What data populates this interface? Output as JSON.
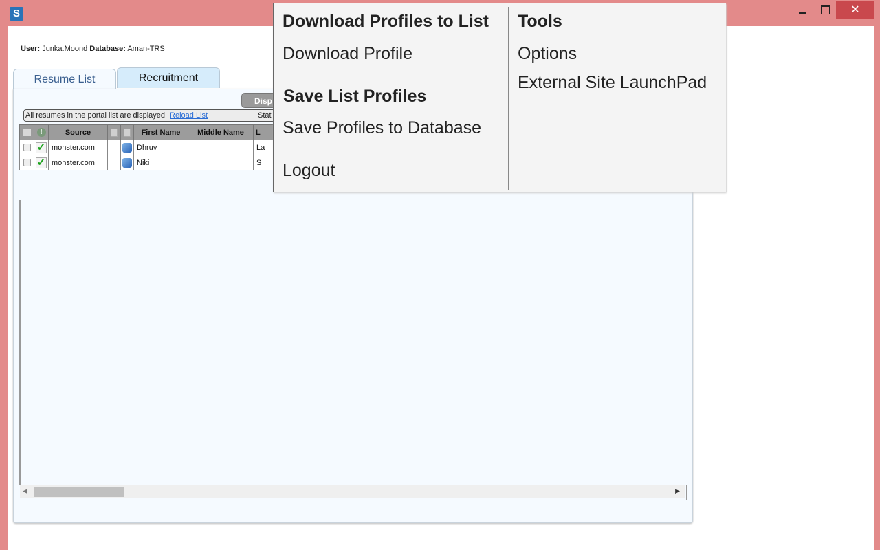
{
  "window": {
    "app_icon": "S",
    "controls": {
      "minimize": "minimize",
      "maximize": "maximize",
      "close": "✕"
    }
  },
  "user_info": {
    "user_label": "User:",
    "user": "Junka.Moond",
    "database_label": "Database:",
    "database": "Aman-TRS"
  },
  "tabs": [
    {
      "label": "Resume List",
      "active": true
    },
    {
      "label": "Recruitment",
      "active": false
    }
  ],
  "toolbar": {
    "display_button": "Disp"
  },
  "status": {
    "message": "All resumes in the portal list are displayed",
    "reload_link": "Reload List",
    "stat_label": "Stat"
  },
  "grid": {
    "columns": [
      "",
      "!",
      "Source",
      "",
      "",
      "First Name",
      "Middle Name",
      "L"
    ],
    "rows": [
      {
        "checked": false,
        "verified": true,
        "source": "monster.com",
        "first_name": "Dhruv",
        "middle_name": "",
        "last_name": "La"
      },
      {
        "checked": false,
        "verified": true,
        "source": "monster.com",
        "first_name": "Niki",
        "middle_name": "",
        "last_name": "S"
      }
    ]
  },
  "menu": {
    "left": {
      "header1": "Download Profiles to List",
      "item1": "Download Profile",
      "header2": "Save List Profiles",
      "item2": "Save Profiles to Database",
      "item3": "Logout"
    },
    "right": {
      "header": "Tools",
      "item1": "Options",
      "item2": "External Site LaunchPad"
    }
  }
}
